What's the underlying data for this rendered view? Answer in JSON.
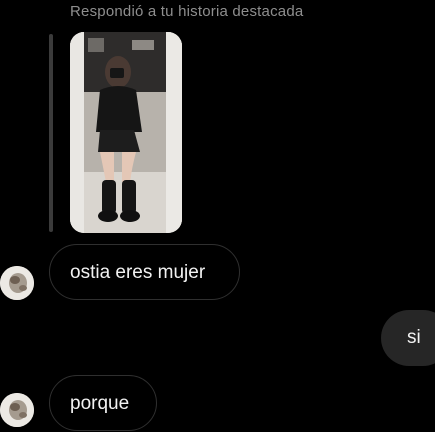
{
  "story_reply": {
    "header": "Respondió a tu historia destacada",
    "thumbnail_alt": "story-thumbnail"
  },
  "messages": [
    {
      "sender": "them",
      "text": "ostia eres mujer"
    },
    {
      "sender": "me",
      "text": "si"
    },
    {
      "sender": "them",
      "text": "porque"
    }
  ]
}
